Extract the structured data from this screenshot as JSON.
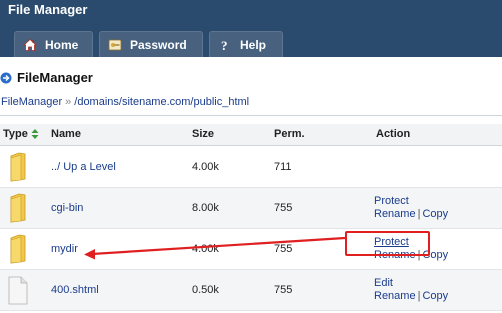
{
  "app": {
    "title": "File Manager"
  },
  "tabs": [
    {
      "label": "Home",
      "icon": "home-icon"
    },
    {
      "label": "Password",
      "icon": "password-icon"
    },
    {
      "label": "Help",
      "icon": "help-icon"
    }
  ],
  "page": {
    "title": "FileManager",
    "icon": "arrow-circle-icon"
  },
  "breadcrumb": {
    "root": "FileManager",
    "separator": "»",
    "path": "/domains/sitename.com/public_html"
  },
  "table": {
    "headers": {
      "type": "Type",
      "name": "Name",
      "size": "Size",
      "perm": "Perm.",
      "action": "Action"
    },
    "rows": [
      {
        "icon": "folder-icon",
        "name": "../ Up a Level",
        "size": "4.00k",
        "perm": "711",
        "actions": []
      },
      {
        "icon": "folder-icon",
        "name": "cgi-bin",
        "size": "8.00k",
        "perm": "755",
        "actions": [
          "Protect",
          "Rename",
          "Copy"
        ]
      },
      {
        "icon": "folder-icon",
        "name": "mydir",
        "size": "4.00k",
        "perm": "755",
        "actions": [
          "Protect",
          "Rename",
          "Copy"
        ]
      },
      {
        "icon": "file-icon",
        "name": "400.shtml",
        "size": "0.50k",
        "perm": "755",
        "actions": [
          "Edit",
          "Rename",
          "Copy"
        ]
      }
    ]
  },
  "annotation": {
    "color": "#e02020"
  },
  "colors": {
    "header_bg": "#2b4b6e",
    "tab_bg": "#47617e",
    "link": "#1a3c8c"
  }
}
